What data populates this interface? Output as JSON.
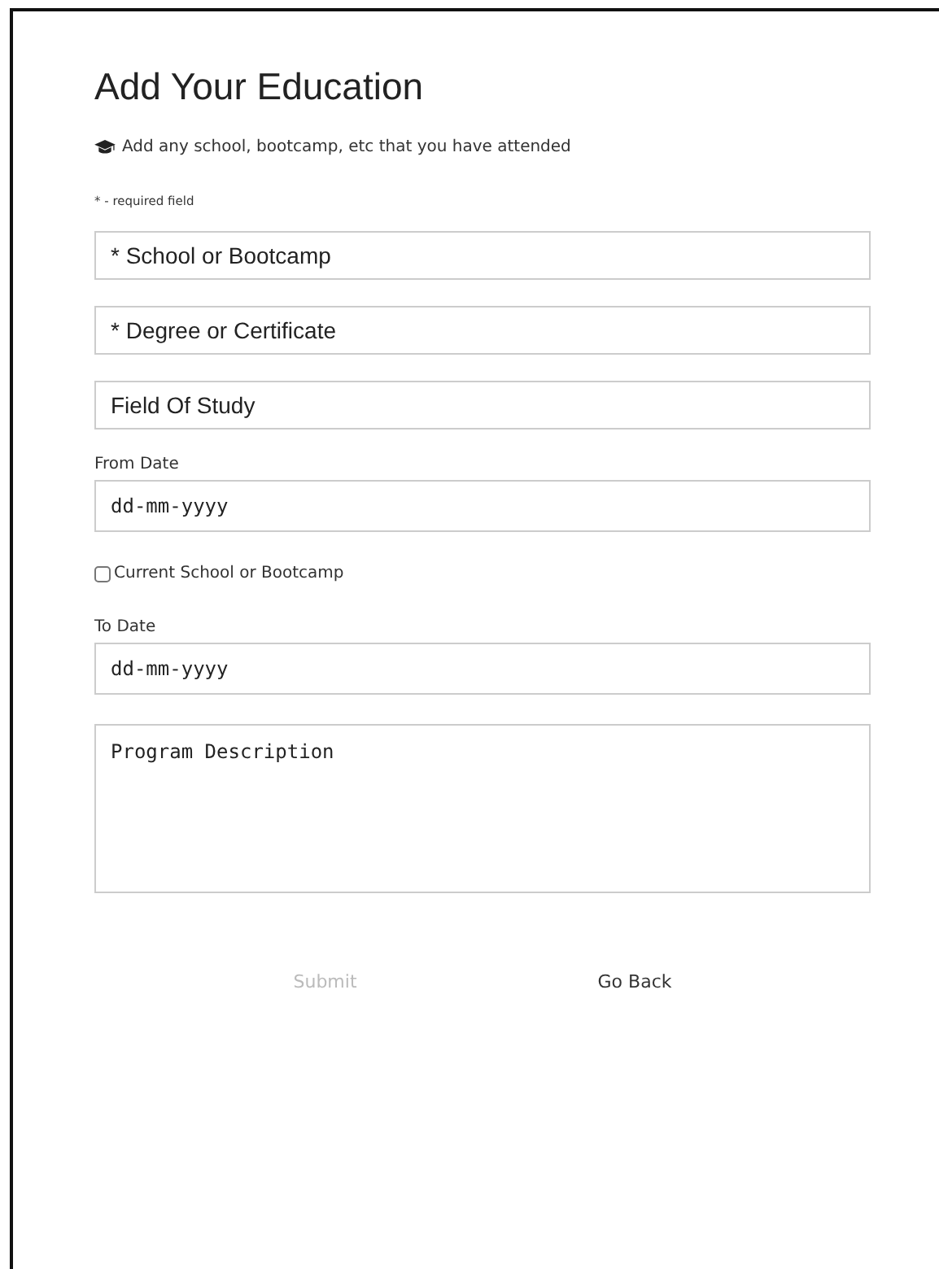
{
  "title": "Add Your Education",
  "subtitle": "Add any school, bootcamp, etc that you have attended",
  "required_note": "* - required field",
  "fields": [
    {
      "kind": "text",
      "placeholder": "* School or Bootcamp"
    },
    {
      "kind": "text",
      "placeholder": "* Degree or Certificate"
    },
    {
      "kind": "text",
      "placeholder": "Field Of Study"
    },
    {
      "kind": "date",
      "label": "From Date",
      "placeholder": "dd-mm-yyyy"
    },
    {
      "kind": "checkbox",
      "label": "Current School or Bootcamp",
      "checked": false
    },
    {
      "kind": "date",
      "label": "To Date",
      "placeholder": "dd-mm-yyyy"
    },
    {
      "kind": "textarea",
      "placeholder": "Program Description"
    }
  ],
  "buttons": [
    {
      "label": "Submit",
      "disabled": true
    },
    {
      "label": "Go Back",
      "disabled": false
    }
  ]
}
